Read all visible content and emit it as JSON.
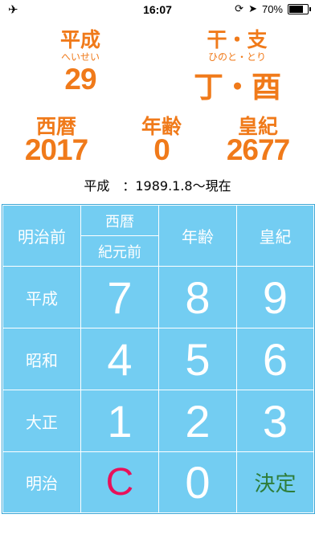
{
  "status_bar": {
    "time": "16:07",
    "battery_percent": "70%"
  },
  "header": {
    "era_label": "平成",
    "era_reading": "へいせい",
    "era_year": "29",
    "eto_label": "干・支",
    "eto_reading": "ひのと・とり",
    "eto_value": "丁・酉",
    "seireki_label": "西暦",
    "seireki_value": "2017",
    "age_label": "年齢",
    "age_value": "0",
    "koki_label": "皇紀",
    "koki_value": "2677",
    "era_range": "平成　：1989.1.8〜現在"
  },
  "keypad": {
    "row0": {
      "left": "明治前",
      "seireki": "西暦",
      "kigenzen": "紀元前",
      "age": "年齢",
      "koki": "皇紀"
    },
    "row1": {
      "left": "平成",
      "k1": "7",
      "k2": "8",
      "k3": "9"
    },
    "row2": {
      "left": "昭和",
      "k1": "4",
      "k2": "5",
      "k3": "6"
    },
    "row3": {
      "left": "大正",
      "k1": "1",
      "k2": "2",
      "k3": "3"
    },
    "row4": {
      "left": "明治",
      "clear": "C",
      "zero": "0",
      "decide": "決定"
    }
  },
  "colors": {
    "accent": "#f07a1a",
    "keypad_bg": "#73cdf2",
    "clear": "#e8115a",
    "decide": "#2e7d3a"
  }
}
